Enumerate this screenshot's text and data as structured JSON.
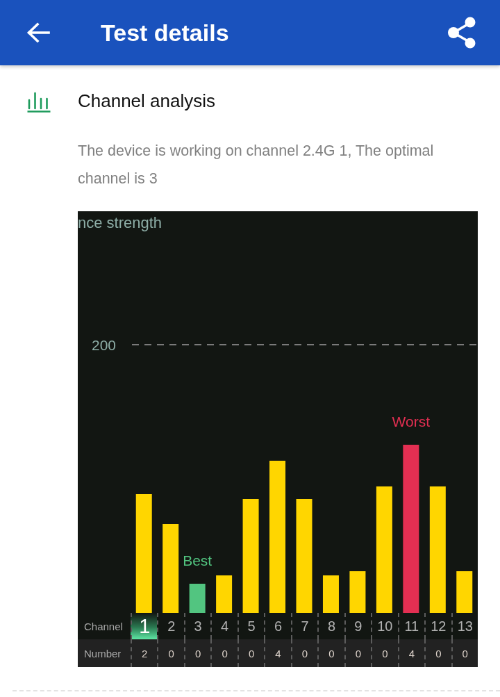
{
  "app_bar": {
    "title": "Test details"
  },
  "section": {
    "title": "Channel analysis",
    "description": "The device is working on channel 2.4G 1, The optimal channel is 3"
  },
  "chart": {
    "axis_title": "nce strength",
    "ytick": "200",
    "channel_label": "Channel",
    "number_label": "Number",
    "channels": [
      {
        "channel": "1",
        "number": "2",
        "selected": true,
        "color": "#ffd600"
      },
      {
        "channel": "2",
        "number": "0",
        "selected": false,
        "color": "#ffd600"
      },
      {
        "channel": "3",
        "number": "0",
        "selected": false,
        "color": "#52c580",
        "tag": "Best"
      },
      {
        "channel": "4",
        "number": "0",
        "selected": false,
        "color": "#ffd600"
      },
      {
        "channel": "5",
        "number": "0",
        "selected": false,
        "color": "#ffd600"
      },
      {
        "channel": "6",
        "number": "4",
        "selected": false,
        "color": "#ffd600"
      },
      {
        "channel": "7",
        "number": "0",
        "selected": false,
        "color": "#ffd600"
      },
      {
        "channel": "8",
        "number": "0",
        "selected": false,
        "color": "#ffd600"
      },
      {
        "channel": "9",
        "number": "0",
        "selected": false,
        "color": "#ffd600"
      },
      {
        "channel": "10",
        "number": "0",
        "selected": false,
        "color": "#ffd600"
      },
      {
        "channel": "11",
        "number": "4",
        "selected": false,
        "color": "#e32f52",
        "tag": "Worst"
      },
      {
        "channel": "12",
        "number": "0",
        "selected": false,
        "color": "#ffd600"
      },
      {
        "channel": "13",
        "number": "0",
        "selected": false,
        "color": "#ffd600"
      }
    ]
  }
}
